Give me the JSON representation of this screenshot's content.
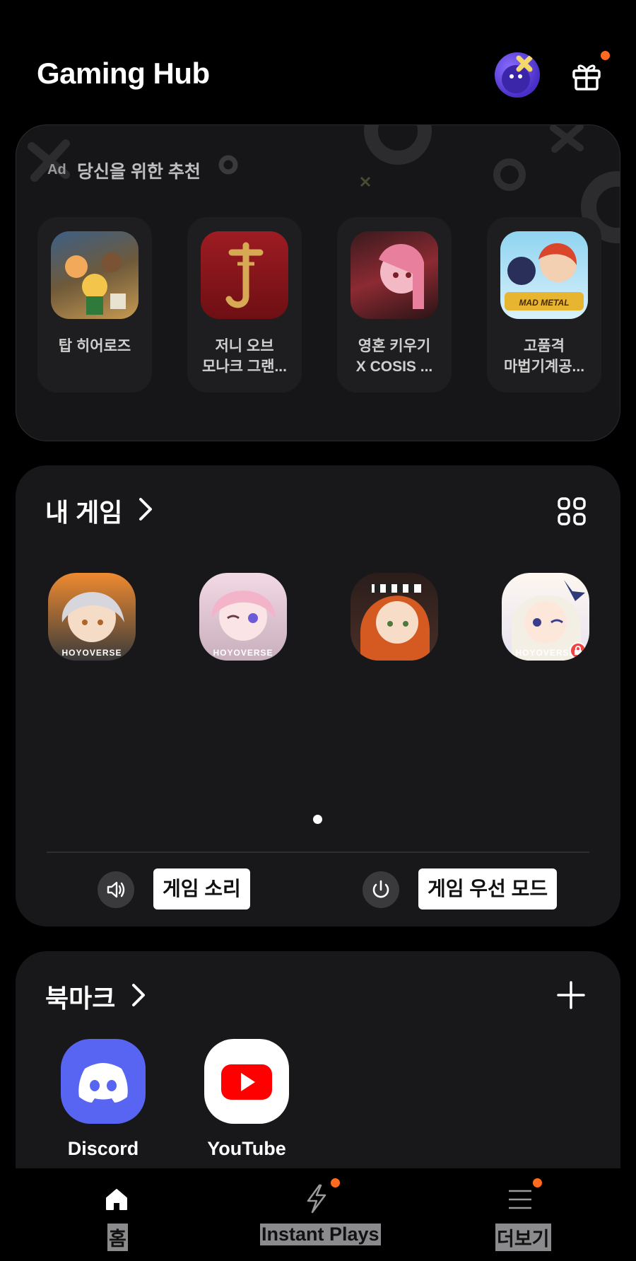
{
  "header": {
    "title": "Gaming Hub",
    "avatar_icon": "avatar-icon",
    "gift_icon": "gift-icon",
    "notification_color": "#ff6a1f"
  },
  "recommendations": {
    "ad_label": "Ad",
    "title": "당신을 위한 추천",
    "items": [
      {
        "name_line1": "탑 히어로즈",
        "name_line2": ""
      },
      {
        "name_line1": "저니 오브",
        "name_line2": "모나크 그랜..."
      },
      {
        "name_line1": "영혼 키우기",
        "name_line2": "X COSIS ..."
      },
      {
        "name_line1": "고품격",
        "name_line2": "마법기계공..."
      }
    ],
    "logo_texts": {
      "mad_metal": "MAD METAL"
    }
  },
  "my_games": {
    "title": "내 게임",
    "badge_text": "HOYOVERSE",
    "game_sound_label": "게임 소리",
    "priority_mode_label": "게임 우선 모드"
  },
  "bookmarks": {
    "title": "북마크",
    "items": [
      {
        "label": "Discord"
      },
      {
        "label": "YouTube"
      }
    ]
  },
  "bottom_nav": {
    "items": [
      {
        "label": "홈"
      },
      {
        "label": "Instant Plays"
      },
      {
        "label": "더보기"
      }
    ]
  }
}
